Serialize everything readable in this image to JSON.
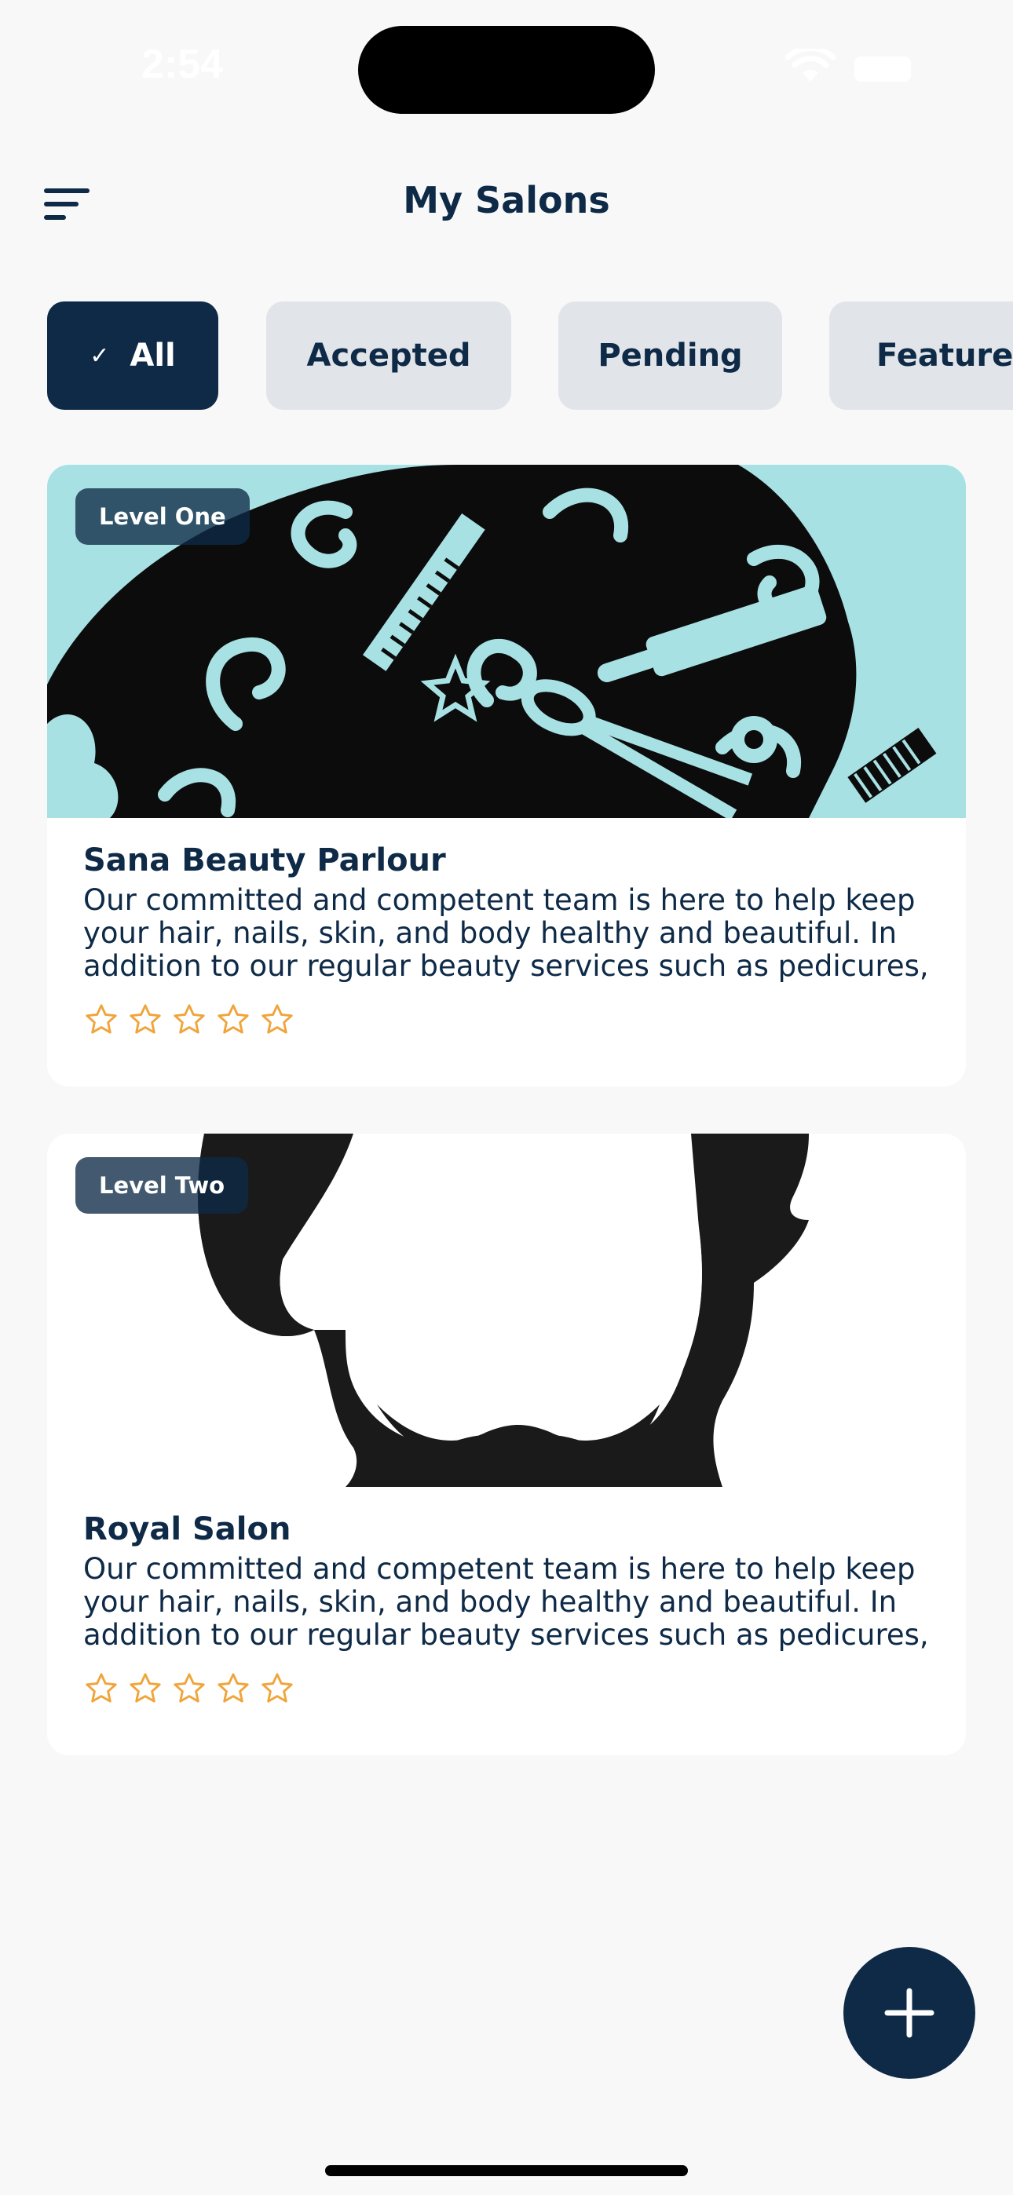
{
  "status_bar": {
    "time": "2:54"
  },
  "header": {
    "title": "My Salons",
    "menu_icon": "menu-icon"
  },
  "filters": [
    {
      "label": "All",
      "selected": true,
      "icon": "check-icon"
    },
    {
      "label": "Accepted",
      "selected": false
    },
    {
      "label": "Pending",
      "selected": false
    },
    {
      "label": "Featured",
      "selected": false
    }
  ],
  "salons": [
    {
      "level": "Level One",
      "name": "Sana Beauty Parlour",
      "description": "Our committed and competent team is here to help keep your hair, nails, skin, and body healthy and beautiful. In addition to our regular beauty services such as pedicures,",
      "rating": 0,
      "max_rating": 5,
      "image": "salon-tools-illustration"
    },
    {
      "level": "Level Two",
      "name": "Royal Salon",
      "description": "Our committed and competent team is here to help keep your hair, nails, skin, and body healthy and beautiful. In addition to our regular beauty services such as pedicures,",
      "rating": 0,
      "max_rating": 5,
      "image": "beard-silhouette-illustration"
    }
  ],
  "fab": {
    "icon": "plus-icon"
  },
  "colors": {
    "primary": "#0e2a47",
    "chip_bg": "#e1e4e9",
    "star": "#f0a43a",
    "image_bg": "#a8e1e3"
  }
}
